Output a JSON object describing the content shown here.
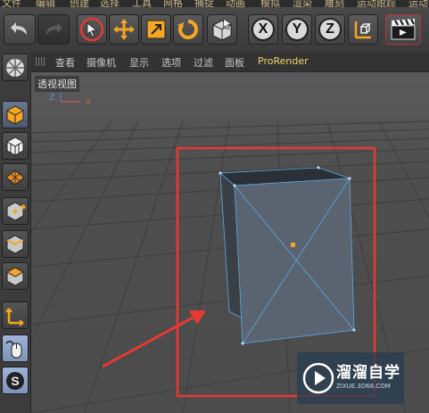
{
  "menubar": {
    "items": [
      "文件",
      "编辑",
      "创建",
      "选择",
      "工具",
      "网格",
      "捕捉",
      "动画",
      "模拟",
      "渲染",
      "雕刻",
      "运动跟踪",
      "运动"
    ]
  },
  "toolbar": {
    "buttons": [
      "undo",
      "redo",
      "select",
      "move",
      "scale",
      "rotate",
      "last-tool",
      "x-axis",
      "y-axis",
      "z-axis",
      "coordinate-system",
      "render-view"
    ],
    "x_label": "X",
    "y_label": "Y",
    "z_label": "Z"
  },
  "viewport_menu": {
    "items": [
      "查看",
      "摄像机",
      "显示",
      "选项",
      "过滤",
      "面板",
      "ProRender"
    ],
    "highlighted": "ProRender"
  },
  "viewport": {
    "label": "透视视图",
    "gizmo": {
      "z": "Z",
      "x": "X"
    }
  },
  "watermark": {
    "title": "溜溜自学",
    "subtitle": "ZIXUE.3D66.COM"
  },
  "colors": {
    "highlight_box": "#e53935",
    "arrow": "#e53935",
    "selection_edges": "#5aa9e6",
    "axis_center": "#f5a623",
    "menu_highlight": "#f0d56a"
  }
}
